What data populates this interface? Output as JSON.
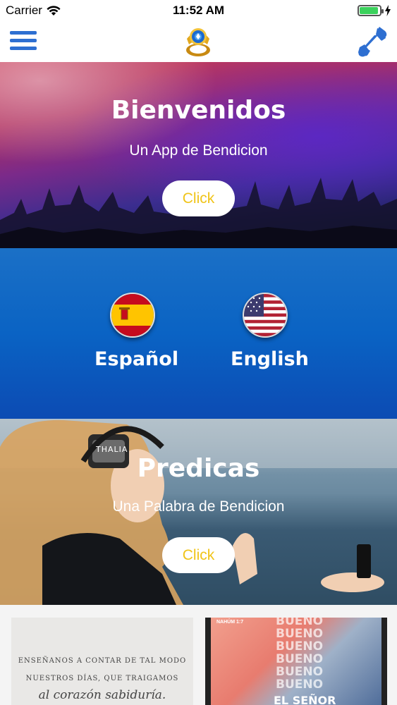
{
  "status_bar": {
    "carrier": "Carrier",
    "time": "11:52 AM"
  },
  "navbar": {
    "menu_icon": "hamburger-menu-icon",
    "logo": "church-ring-logo",
    "call_icon": "phone-icon"
  },
  "colors": {
    "accent_blue": "#2e6fd1",
    "button_text": "#f0c419",
    "language_bg": "#0a63c4"
  },
  "hero_welcome": {
    "title": "Bienvenidos",
    "subtitle": "Un App de Bendicion",
    "button_label": "Click"
  },
  "languages": [
    {
      "label": "Español",
      "flag": "spain-flag-icon"
    },
    {
      "label": "English",
      "flag": "usa-flag-icon"
    }
  ],
  "hero_predicas": {
    "title": "Predicas",
    "subtitle": "Una Palabra de Bendicion",
    "button_label": "Click",
    "headphones_brand": "THALIA"
  },
  "thumbnails": [
    {
      "lines": [
        "ENSEÑANOS A CONTAR DE TAL MODO",
        "NUESTROS DÍAS, QUE TRAIGAMOS",
        "al corazón sabiduría."
      ]
    },
    {
      "ref": "NAHÚM 1:7",
      "word": "BUENO",
      "caption": "EL SEÑOR"
    }
  ]
}
